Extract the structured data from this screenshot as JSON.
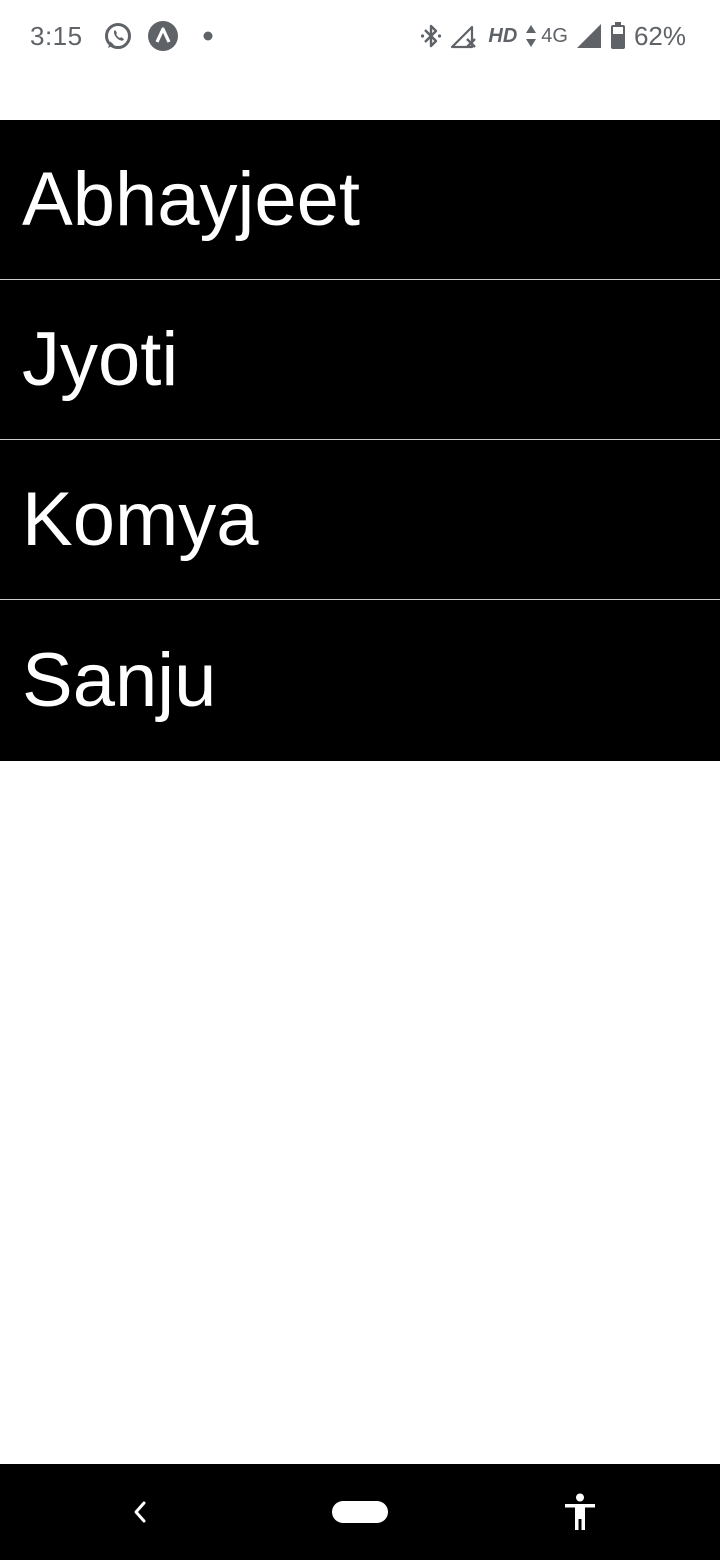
{
  "status_bar": {
    "time": "3:15",
    "hd": "HD",
    "network": "4G",
    "battery": "62%",
    "icons": [
      "whatsapp-icon",
      "app-icon",
      "dot-icon",
      "bluetooth-icon",
      "signal-off-icon",
      "data-arrows-icon",
      "signal-icon",
      "battery-icon"
    ]
  },
  "list": {
    "items": [
      {
        "label": "Abhayjeet"
      },
      {
        "label": "Jyoti"
      },
      {
        "label": "Komya"
      },
      {
        "label": "Sanju"
      }
    ]
  },
  "colors": {
    "row_background": "#000000",
    "row_text": "#ffffff",
    "divider": "#cccccc",
    "status_text": "#5f6368"
  },
  "nav_bar": {
    "icons": [
      "back-icon",
      "home-pill-icon",
      "accessibility-icon"
    ]
  }
}
